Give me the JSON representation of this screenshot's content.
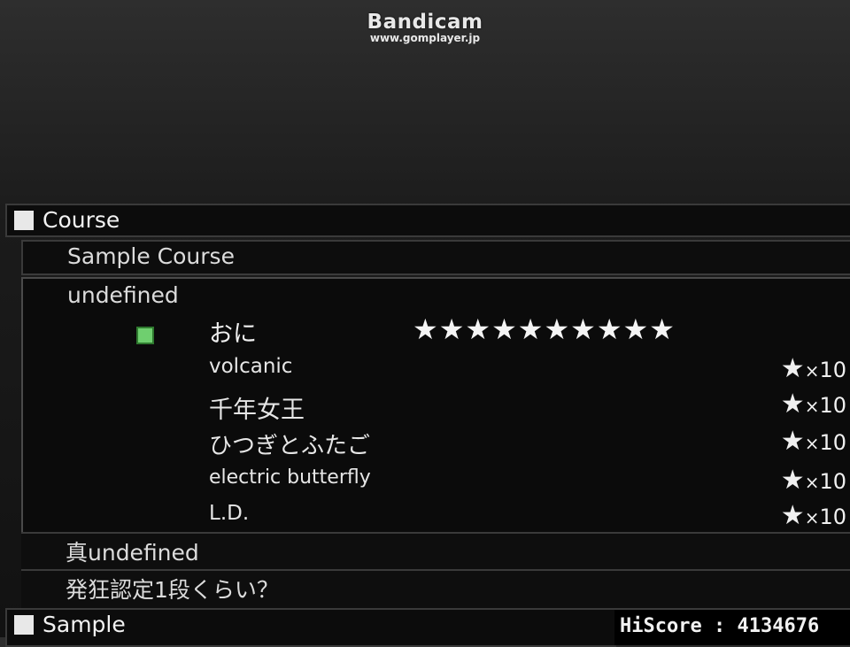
{
  "watermark": {
    "title": "Bandicam",
    "url": "www.gomplayer.jp"
  },
  "course_header": {
    "label": "Course"
  },
  "course_name": "Sample Course",
  "course_panel": {
    "title": "undefined",
    "difficulty": {
      "name": "おに",
      "stars": "★★★★★★★★★★",
      "indicator_color": "#6fcf6f"
    },
    "songs": [
      {
        "name": "volcanic",
        "star": "★",
        "mult": "×",
        "level": "10"
      },
      {
        "name": "千年女王",
        "star": "★",
        "mult": "×",
        "level": "10"
      },
      {
        "name": "ひつぎとふたご",
        "star": "★",
        "mult": "×",
        "level": "10"
      },
      {
        "name": "electric butterfly",
        "star": "★",
        "mult": "×",
        "level": "10"
      },
      {
        "name": "L.D.",
        "star": "★",
        "mult": "×",
        "level": "10"
      }
    ]
  },
  "course_list": [
    {
      "label": "真undefined"
    },
    {
      "label": "発狂認定1段くらい？"
    }
  ],
  "sample_header": {
    "label": "Sample"
  },
  "hiscore": {
    "label": "HiScore",
    "sep": ":",
    "value": "4134676"
  }
}
